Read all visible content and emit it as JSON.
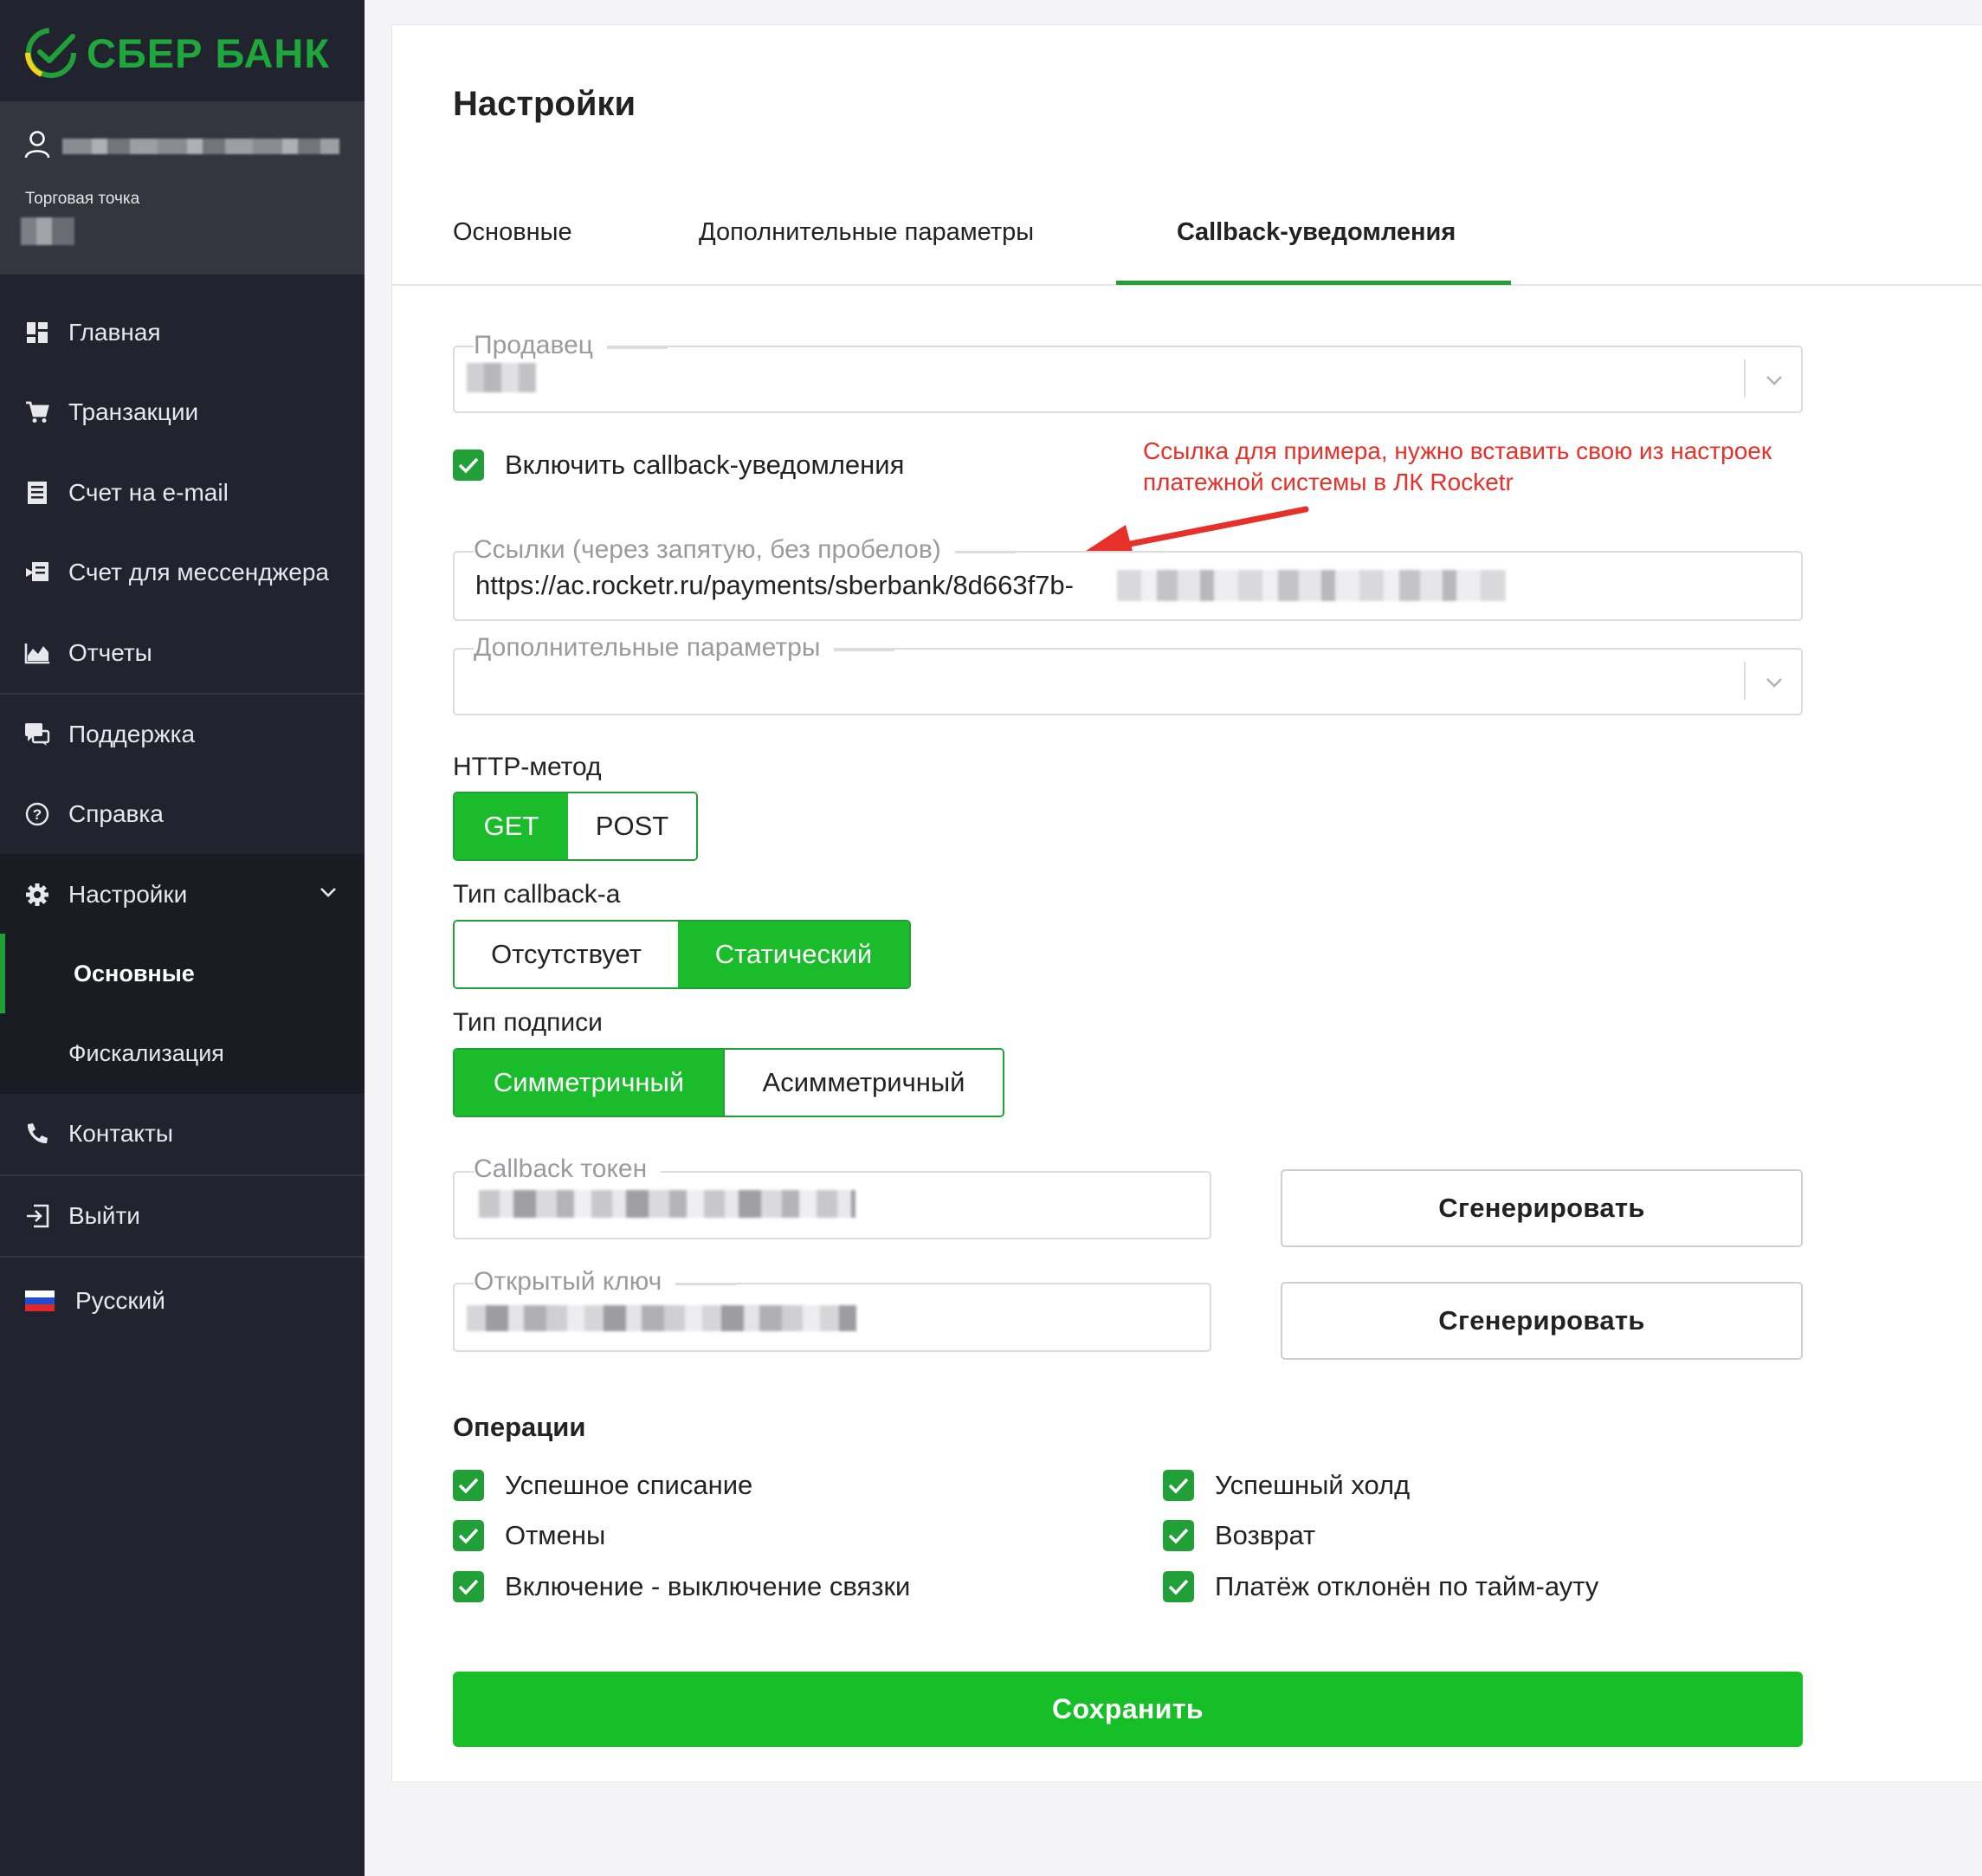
{
  "brand": {
    "name": "СБЕР БАНК",
    "logo_color": "#21a038"
  },
  "user": {
    "role_label": "Торговая точка"
  },
  "sidebar": {
    "items": [
      {
        "label": "Главная",
        "icon": "dashboard-icon"
      },
      {
        "label": "Транзакции",
        "icon": "cart-icon"
      },
      {
        "label": "Счет на e-mail",
        "icon": "invoice-icon"
      },
      {
        "label": "Счет для мессенджера",
        "icon": "messenger-invoice-icon"
      },
      {
        "label": "Отчеты",
        "icon": "chart-icon"
      },
      {
        "label": "Поддержка",
        "icon": "support-chat-icon"
      },
      {
        "label": "Справка",
        "icon": "help-icon"
      },
      {
        "label": "Настройки",
        "icon": "gear-icon",
        "expanded": true
      },
      {
        "label": "Контакты",
        "icon": "phone-icon"
      },
      {
        "label": "Выйти",
        "icon": "logout-icon"
      }
    ],
    "settings_sub": [
      {
        "label": "Основные",
        "active": true
      },
      {
        "label": "Фискализация",
        "active": false
      }
    ],
    "language": {
      "label": "Русский",
      "icon": "russia-flag-icon"
    }
  },
  "page": {
    "title": "Настройки",
    "tabs": [
      {
        "label": "Основные",
        "active": false
      },
      {
        "label": "Дополнительные параметры",
        "active": false
      },
      {
        "label": "Callback-уведомления",
        "active": true
      }
    ]
  },
  "form": {
    "seller": {
      "label": "Продавец",
      "value": ""
    },
    "enable_callbacks": {
      "label": "Включить callback-уведомления",
      "checked": true
    },
    "annotation": {
      "line1": "Ссылка для примера, нужно вставить свою из настроек",
      "line2": "платежной системы в ЛК Rocketr"
    },
    "links": {
      "label": "Ссылки (через запятую, без пробелов)",
      "value": "https://ac.rocketr.ru/payments/sberbank/8d663f7b-"
    },
    "extra_params": {
      "label": "Дополнительные параметры",
      "value": ""
    },
    "http_method": {
      "label": "HTTP-метод",
      "options": [
        "GET",
        "POST"
      ],
      "selected": "GET"
    },
    "callback_type": {
      "label": "Тип callback-а",
      "options": [
        "Отсутствует",
        "Статический"
      ],
      "selected": "Статический"
    },
    "signature_type": {
      "label": "Тип подписи",
      "options": [
        "Симметричный",
        "Асимметричный"
      ],
      "selected": "Симметричный"
    },
    "callback_token": {
      "label": "Callback токен",
      "button": "Сгенерировать"
    },
    "public_key": {
      "label": "Открытый ключ",
      "button": "Сгенерировать"
    },
    "operations": {
      "title": "Операции",
      "items": [
        {
          "label": "Успешное списание",
          "checked": true
        },
        {
          "label": "Успешный холд",
          "checked": true
        },
        {
          "label": "Отмены",
          "checked": true
        },
        {
          "label": "Возврат",
          "checked": true
        },
        {
          "label": "Включение - выключение связки",
          "checked": true
        },
        {
          "label": "Платёж отклонён по тайм-ауту",
          "checked": true
        }
      ]
    },
    "save_label": "Сохранить"
  },
  "colors": {
    "accent": "#21a038",
    "button_green": "#16bf28",
    "sidebar_bg": "#21232f",
    "annotation": "#e8302a"
  }
}
